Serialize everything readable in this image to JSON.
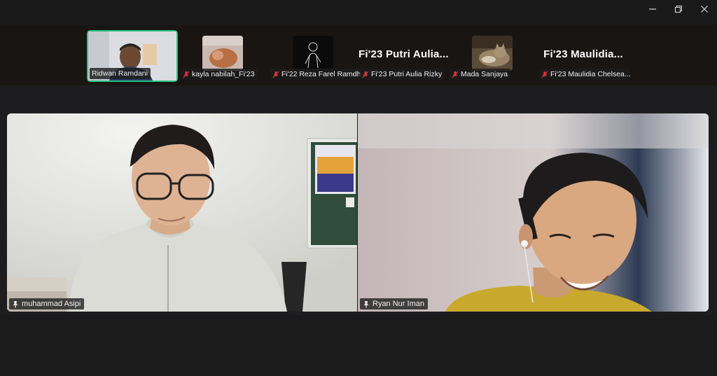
{
  "window": {
    "controls": {
      "minimize_icon": "minimize-icon",
      "restore_icon": "restore-icon",
      "close_icon": "close-icon"
    }
  },
  "strip": {
    "participants": [
      {
        "name": "Ridwan Ramdani",
        "muted": false,
        "active_speaker": true
      },
      {
        "name": "kayla nabilah_Fi'23",
        "muted": true
      },
      {
        "name": "Fi'22 Reza Farel Ramdh...",
        "muted": true
      },
      {
        "name": "Fi'23 Putri Aulia Rizky",
        "display_text": "Fi'23 Putri Aulia...",
        "muted": true
      },
      {
        "name": "Mada Sanjaya",
        "muted": true
      },
      {
        "name": "Fi'23 Maulidia Chelsea...",
        "display_text": "Fi'23 Maulidia...",
        "muted": true
      }
    ]
  },
  "main": {
    "videos": [
      {
        "name": "muhammad Asipi",
        "pinned": true
      },
      {
        "name": "Ryan Nur Iman",
        "pinned": true
      }
    ]
  },
  "colors": {
    "active_speaker_border": "#29c282",
    "mic_off": "#e0393e",
    "background": "#1d1d1f"
  }
}
